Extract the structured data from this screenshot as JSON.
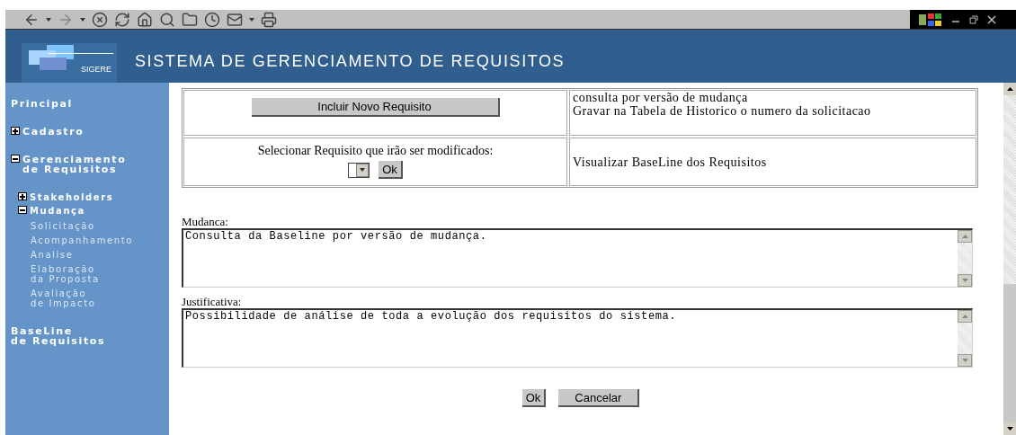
{
  "header": {
    "logo_text": "SIGERE",
    "title": "SISTEMA DE GERENCIAMENTO DE REQUISITOS"
  },
  "sidebar": {
    "items": [
      {
        "label": "Principal"
      },
      {
        "label": "Cadastro",
        "expanded": false
      },
      {
        "label": "Gerenciamento\nde Requisitos",
        "expanded": true,
        "children": [
          {
            "label": "Stakeholders",
            "expanded": false
          },
          {
            "label": "Mudança",
            "expanded": true,
            "children": [
              {
                "label": "Solicitação"
              },
              {
                "label": "Acompanhamento"
              },
              {
                "label": "Analise"
              },
              {
                "label": "Elaboração\nda Proposta"
              },
              {
                "label": "Avaliação\nde Impacto"
              }
            ]
          }
        ]
      },
      {
        "label": "BaseLine\nde Requisitos"
      }
    ]
  },
  "actions_table": {
    "include_button": "Incluir Novo Requisito",
    "note": "consulta por versão de mudança\nGravar na Tabela de Historico o numero da solicitacao",
    "select_label": "Selecionar Requisito que irão ser modificados:",
    "select_ok": "Ok",
    "baseline_link": "Visualizar BaseLine dos Requisitos"
  },
  "form": {
    "fields": [
      {
        "label": "Mudanca:",
        "value": "Consulta da Baseline por versão de mudança."
      },
      {
        "label": "Justificativa:",
        "value": "Possibilidade de análise de toda a evolução dos requisitos do sistema."
      }
    ],
    "buttons": [
      "Ok",
      "Cancelar"
    ]
  }
}
